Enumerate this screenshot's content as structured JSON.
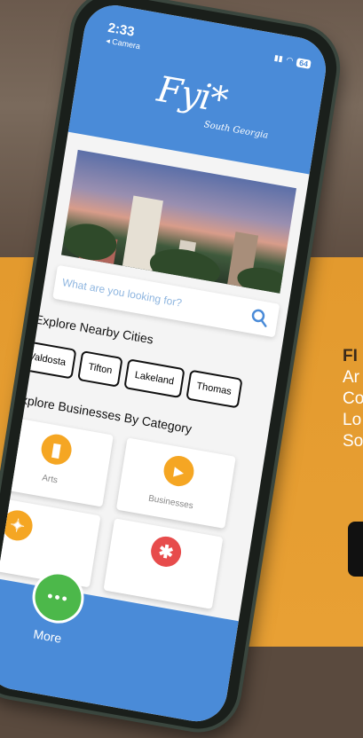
{
  "status": {
    "time": "2:33",
    "back": "◂ Camera",
    "battery": "64"
  },
  "brand": {
    "logo": "Fyi*",
    "subtitle": "South Georgia"
  },
  "search": {
    "placeholder": "What are you looking for?"
  },
  "cities": {
    "title": "Explore Nearby Cities",
    "items": [
      "Valdosta",
      "Tifton",
      "Lakeland",
      "Thomas"
    ]
  },
  "categories": {
    "title": "Explore Businesses By Category",
    "items": [
      {
        "label": "Arts",
        "icon": "paint-roller-icon",
        "color": "#f5a623"
      },
      {
        "label": "Businesses",
        "icon": "play-icon",
        "color": "#f5a623"
      },
      {
        "label": "",
        "icon": "person-icon",
        "color": "#f5a623"
      },
      {
        "label": "",
        "icon": "asterisk-icon",
        "color": "#e74c4c"
      }
    ]
  },
  "nav": {
    "more_label": "More",
    "more_dots": "•••"
  },
  "background": {
    "head": "FI",
    "lines": [
      "Ar",
      "Co",
      "Lo",
      "So"
    ]
  },
  "colors": {
    "primary": "#4a8bd8",
    "accent": "#f5a623",
    "more": "#4cb84a",
    "orange_bg": "#e39a2e"
  }
}
